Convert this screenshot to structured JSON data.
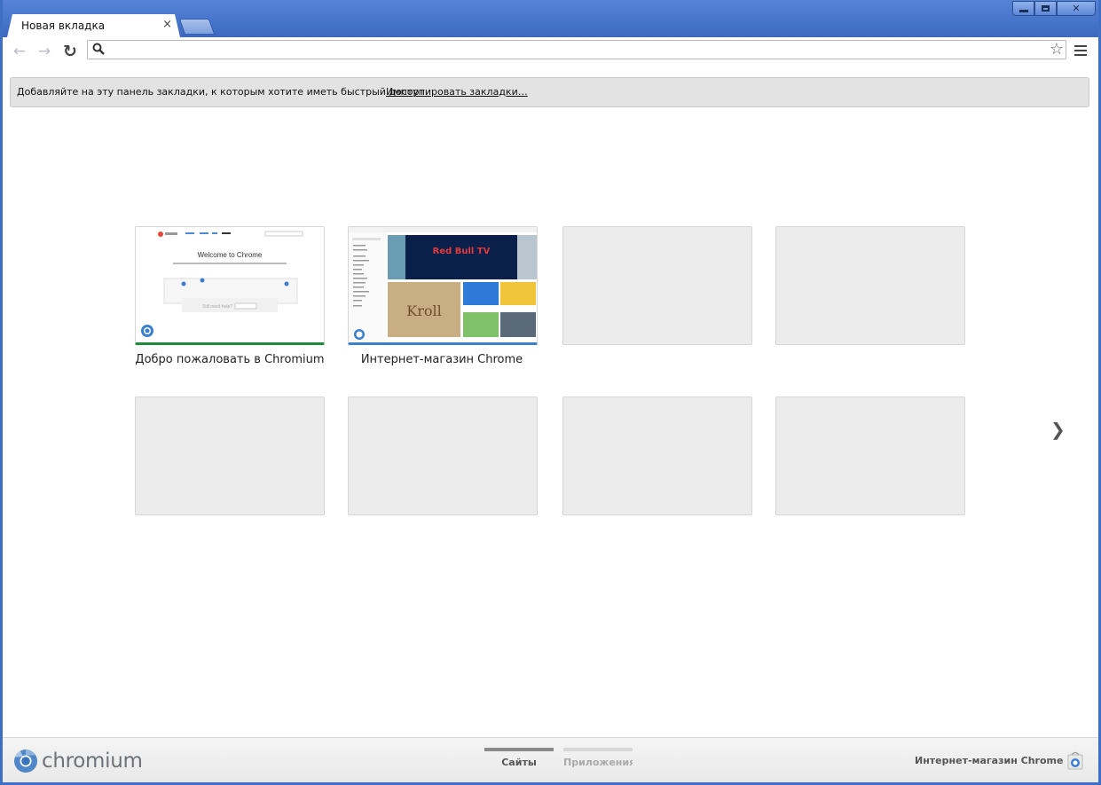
{
  "window": {
    "controls": {
      "minimize": "",
      "maximize": "",
      "close": "✕"
    }
  },
  "tabs": [
    {
      "title": "Новая вкладка",
      "close_glyph": "×"
    }
  ],
  "toolbar": {
    "back_glyph": "←",
    "forward_glyph": "→",
    "reload_glyph": "↻",
    "omnibox_value": "",
    "omnibox_placeholder": "",
    "star_glyph": "☆"
  },
  "bookmark_bar": {
    "text": "Добавляйте на эту панель закладки, к которым хотите иметь быстрый доступ.",
    "import_link": "Импортировать закладки…"
  },
  "most_visited": [
    {
      "title": "Добро пожаловать в Chromium",
      "accent": "#1e8c3c"
    },
    {
      "title": "Интернет-магазин Chrome",
      "accent": "#3b7fd1"
    },
    {
      "title": ""
    },
    {
      "title": ""
    },
    {
      "title": ""
    },
    {
      "title": ""
    },
    {
      "title": ""
    },
    {
      "title": ""
    }
  ],
  "thumb_welcome": {
    "header": "Welcome to Chrome",
    "sub": "You're using a fast new browser. Sit back and let us show you around.",
    "help": "Still need help?"
  },
  "thumb_store": {
    "banner": "Red Bull TV",
    "tile": "Kroll"
  },
  "pager": {
    "next_glyph": "❯"
  },
  "footer": {
    "logo_text": "chromium",
    "sections": [
      {
        "label": "Сайты",
        "active": true
      },
      {
        "label": "Приложения",
        "active": false
      }
    ],
    "store_link": "Интернет-магазин Chrome"
  },
  "colors": {
    "frame": "#3f6fc4",
    "active_section_bar": "#8a8a8a",
    "inactive_section_bar": "#d7d7d7"
  }
}
